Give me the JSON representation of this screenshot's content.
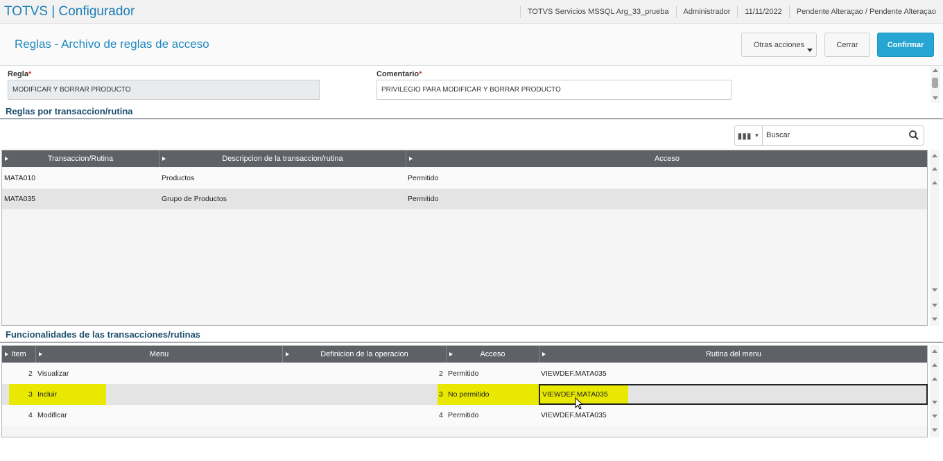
{
  "app": {
    "title": "TOTVS | Configurador",
    "environment": "TOTVS Servicios MSSQL Arg_33_prueba",
    "user": "Administrador",
    "date": "11/11/2022",
    "status": "Pendente Alteraçao / Pendente Alteraçao"
  },
  "page": {
    "title": "Reglas - Archivo de reglas de acceso",
    "actions": {
      "more": "Otras acciones",
      "close": "Cerrar",
      "confirm": "Confirmar"
    }
  },
  "form": {
    "regla_label": "Regla",
    "regla_value": "MODIFICAR Y BORRAR PRODUCTO",
    "comentario_label": "Comentario",
    "comentario_value": "PRIVILEGIO PARA MODIFICAR Y BORRAR PRODUCTO",
    "required_mark": "*"
  },
  "rules_section": {
    "title": "Reglas por transaccion/rutina",
    "search_placeholder": "Buscar",
    "columns": [
      "Transaccion/Rutina",
      "Descripcion de la transaccion/rutina",
      "Acceso"
    ],
    "rows": [
      {
        "code": "MATA010",
        "description": "Productos",
        "access": "Permitido"
      },
      {
        "code": "MATA035",
        "description": "Grupo de Productos",
        "access": "Permitido"
      }
    ]
  },
  "functions_section": {
    "title": "Funcionalidades de las transacciones/rutinas",
    "columns": [
      "Item",
      "Menu",
      "Definicion de la operacion",
      "Acceso",
      "Rutina del menu"
    ],
    "rows": [
      {
        "item": "2",
        "menu": "Visualizar",
        "definition": "",
        "access_code": "2",
        "access": "Permitido",
        "routine": "VIEWDEF.MATA035"
      },
      {
        "item": "3",
        "menu": "Incluir",
        "definition": "",
        "access_code": "3",
        "access": "No permitido",
        "routine": "VIEWDEF.MATA035"
      },
      {
        "item": "4",
        "menu": "Modificar",
        "definition": "",
        "access_code": "4",
        "access": "Permitido",
        "routine": "VIEWDEF.MATA035"
      }
    ]
  },
  "colors": {
    "accent": "#1e88c0",
    "confirm": "#27a5d3",
    "header": "#5e6267",
    "highlight": "#e8e800"
  }
}
